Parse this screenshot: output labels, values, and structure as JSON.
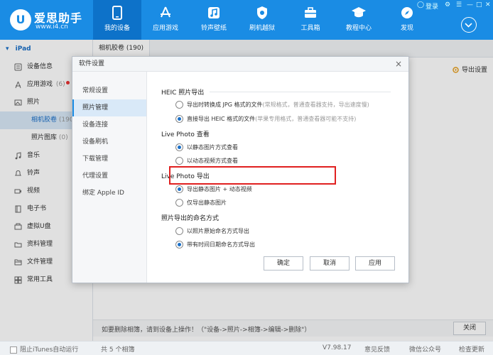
{
  "app": {
    "name": "爱思助手",
    "url": "www.i4.cn",
    "window_controls": [
      "登录"
    ]
  },
  "nav": [
    {
      "label": "我的设备",
      "icon": "phone-icon",
      "active": true
    },
    {
      "label": "应用游戏",
      "icon": "app-store-icon",
      "active": false
    },
    {
      "label": "铃声壁纸",
      "icon": "music-icon",
      "active": false
    },
    {
      "label": "刷机越狱",
      "icon": "shield-icon",
      "active": false
    },
    {
      "label": "工具箱",
      "icon": "toolbox-icon",
      "active": false
    },
    {
      "label": "教程中心",
      "icon": "graduation-cap-icon",
      "active": false
    },
    {
      "label": "发现",
      "icon": "compass-icon",
      "active": false
    }
  ],
  "sidebar": {
    "device": "iPad",
    "items": [
      {
        "label": "设备信息",
        "count": ""
      },
      {
        "label": "应用游戏",
        "count": "(6)"
      },
      {
        "label": "照片",
        "count": ""
      },
      {
        "label": "音乐",
        "count": ""
      },
      {
        "label": "铃声",
        "count": ""
      },
      {
        "label": "视频",
        "count": ""
      },
      {
        "label": "电子书",
        "count": ""
      },
      {
        "label": "虚拟U盘",
        "count": ""
      },
      {
        "label": "资料管理",
        "count": ""
      },
      {
        "label": "文件管理",
        "count": ""
      },
      {
        "label": "常用工具",
        "count": ""
      }
    ],
    "photo_subitems": [
      {
        "label": "相机胶卷",
        "count": "(190)"
      },
      {
        "label": "照片图库",
        "count": "(0)"
      }
    ]
  },
  "main": {
    "tab": "相机胶卷 (190)",
    "export_button": "导出设置",
    "tip": "如要删除相簿，请到设备上操作！（\"设备->照片->相簿->编辑->删除\"）",
    "close_button": "关闭"
  },
  "statusbar": {
    "itunes_block": "阻止iTunes自动运行",
    "album_count": "共 5 个相簿",
    "version": "V7.98.17",
    "feedback": "意见反馈",
    "wechat": "微信公众号",
    "update": "检查更新"
  },
  "dialog": {
    "title": "软件设置",
    "nav": [
      {
        "label": "常规设置",
        "active": false
      },
      {
        "label": "照片管理",
        "active": true
      },
      {
        "label": "设备连接",
        "active": false
      },
      {
        "label": "设备刷机",
        "active": false
      },
      {
        "label": "下载管理",
        "active": false
      },
      {
        "label": "代理设置",
        "active": false
      },
      {
        "label": "绑定 Apple ID",
        "active": false
      }
    ],
    "sections": [
      {
        "title": "HEIC 照片导出",
        "options": [
          {
            "label": "导出时转换成 JPG 格式的文件",
            "hint": "(常规格式，普通查看器支持，导出速度慢)",
            "selected": false
          },
          {
            "label": "直接导出 HEIC 格式的文件",
            "hint": "(苹果专用格式，普通查看器可能不支持)",
            "selected": true
          }
        ]
      },
      {
        "title": "Live Photo 查看",
        "options": [
          {
            "label": "以静态图片方式查看",
            "hint": "",
            "selected": true
          },
          {
            "label": "以动态视频方式查看",
            "hint": "",
            "selected": false
          }
        ]
      },
      {
        "title": "Live Photo 导出",
        "options": [
          {
            "label": "导出静态图片 + 动态视频",
            "hint": "",
            "selected": true
          },
          {
            "label": "仅导出静态图片",
            "hint": "",
            "selected": false
          }
        ]
      },
      {
        "title": "照片导出的命名方式",
        "options": [
          {
            "label": "以照片原始命名方式导出",
            "hint": "",
            "selected": false
          },
          {
            "label": "带有时间日期命名方式导出",
            "hint": "",
            "selected": true
          }
        ]
      }
    ],
    "buttons": {
      "ok": "确定",
      "cancel": "取消",
      "apply": "应用"
    }
  }
}
